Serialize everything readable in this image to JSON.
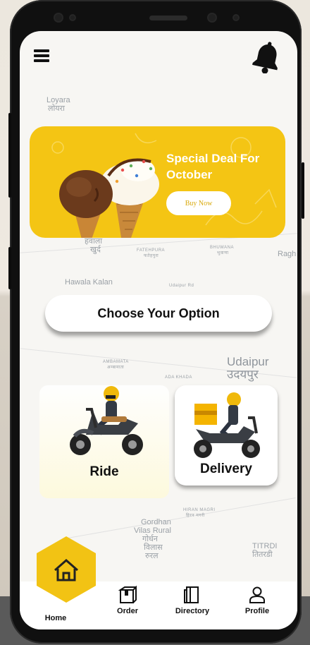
{
  "header": {
    "menu_icon": "hamburger-menu-icon",
    "bell_icon": "bell-icon"
  },
  "map_labels": [
    {
      "text": "Loyara",
      "key": "loyara"
    },
    {
      "text": "लोयरा",
      "key": "loyara_hi"
    },
    {
      "text": "हवाला",
      "key": "hawala_hi"
    },
    {
      "text": "खुर्द",
      "key": "khurd_hi"
    },
    {
      "text": "FATEHPURA",
      "key": "fatehpura"
    },
    {
      "text": "फतेहपुरा",
      "key": "fatehpura_hi"
    },
    {
      "text": "BHUWANA",
      "key": "bhuwana"
    },
    {
      "text": "भुवाणा",
      "key": "bhuwana_hi"
    },
    {
      "text": "Hawala Kalan",
      "key": "hawala_kalan"
    },
    {
      "text": "Udaipur Rd",
      "key": "udaipur_rd"
    },
    {
      "text": "AMBAMATA",
      "key": "ambamata"
    },
    {
      "text": "अम्बामाता",
      "key": "ambamata_hi"
    },
    {
      "text": "ADA KHADA",
      "key": "ada_khada"
    },
    {
      "text": "Udaipur",
      "key": "udaipur"
    },
    {
      "text": "उदयपुर",
      "key": "udaipur_hi"
    },
    {
      "text": "HIRAN MAGRI",
      "key": "hiran_magri"
    },
    {
      "text": "हिरन मगरी",
      "key": "hiran_magri_hi"
    },
    {
      "text": "Gordhan",
      "key": "gordhan"
    },
    {
      "text": "Vilas Rural",
      "key": "vilas_rural"
    },
    {
      "text": "गोर्धन",
      "key": "gordhan_hi"
    },
    {
      "text": "विलास",
      "key": "vilas_hi"
    },
    {
      "text": "रुरल",
      "key": "rural_hi"
    },
    {
      "text": "TITRDI",
      "key": "titrdi"
    },
    {
      "text": "तितरडी",
      "key": "titrdi_hi"
    },
    {
      "text": "Ragh",
      "key": "ragh"
    }
  ],
  "banner": {
    "title": "Special Deal For October",
    "button_label": "Buy Now"
  },
  "choose_option": {
    "label": "Choose Your Option"
  },
  "options": {
    "ride_label": "Ride",
    "delivery_label": "Delivery"
  },
  "bottom_nav": {
    "home": "Home",
    "order": "Order",
    "directory": "Directory",
    "profile": "Profile"
  },
  "colors": {
    "accent_yellow": "#f4c514",
    "text_dark": "#111111",
    "map_text": "#9aa0a6"
  }
}
